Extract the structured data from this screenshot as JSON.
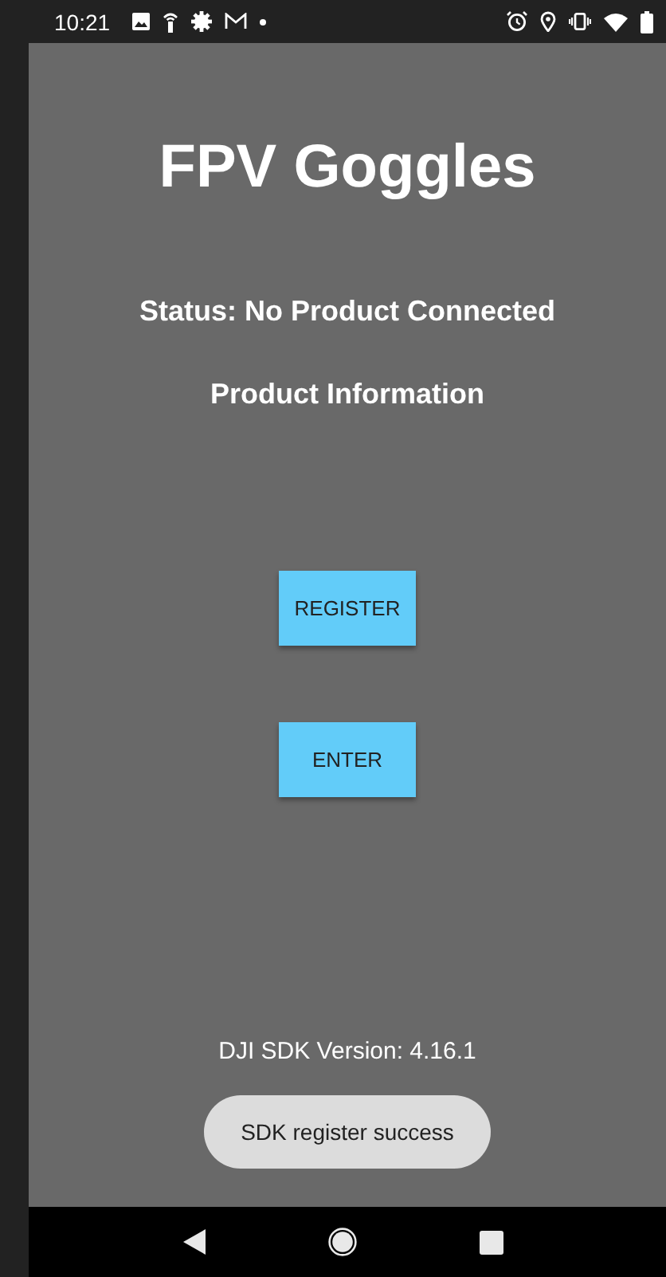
{
  "status_bar": {
    "time": "10:21"
  },
  "title": "FPV Goggles",
  "status": "Status: No Product Connected",
  "product_info": "Product Information",
  "buttons": [
    {
      "label": "REGISTER"
    },
    {
      "label": "ENTER"
    }
  ],
  "sdk_version": "DJI SDK Version: 4.16.1",
  "toast": "SDK register success"
}
